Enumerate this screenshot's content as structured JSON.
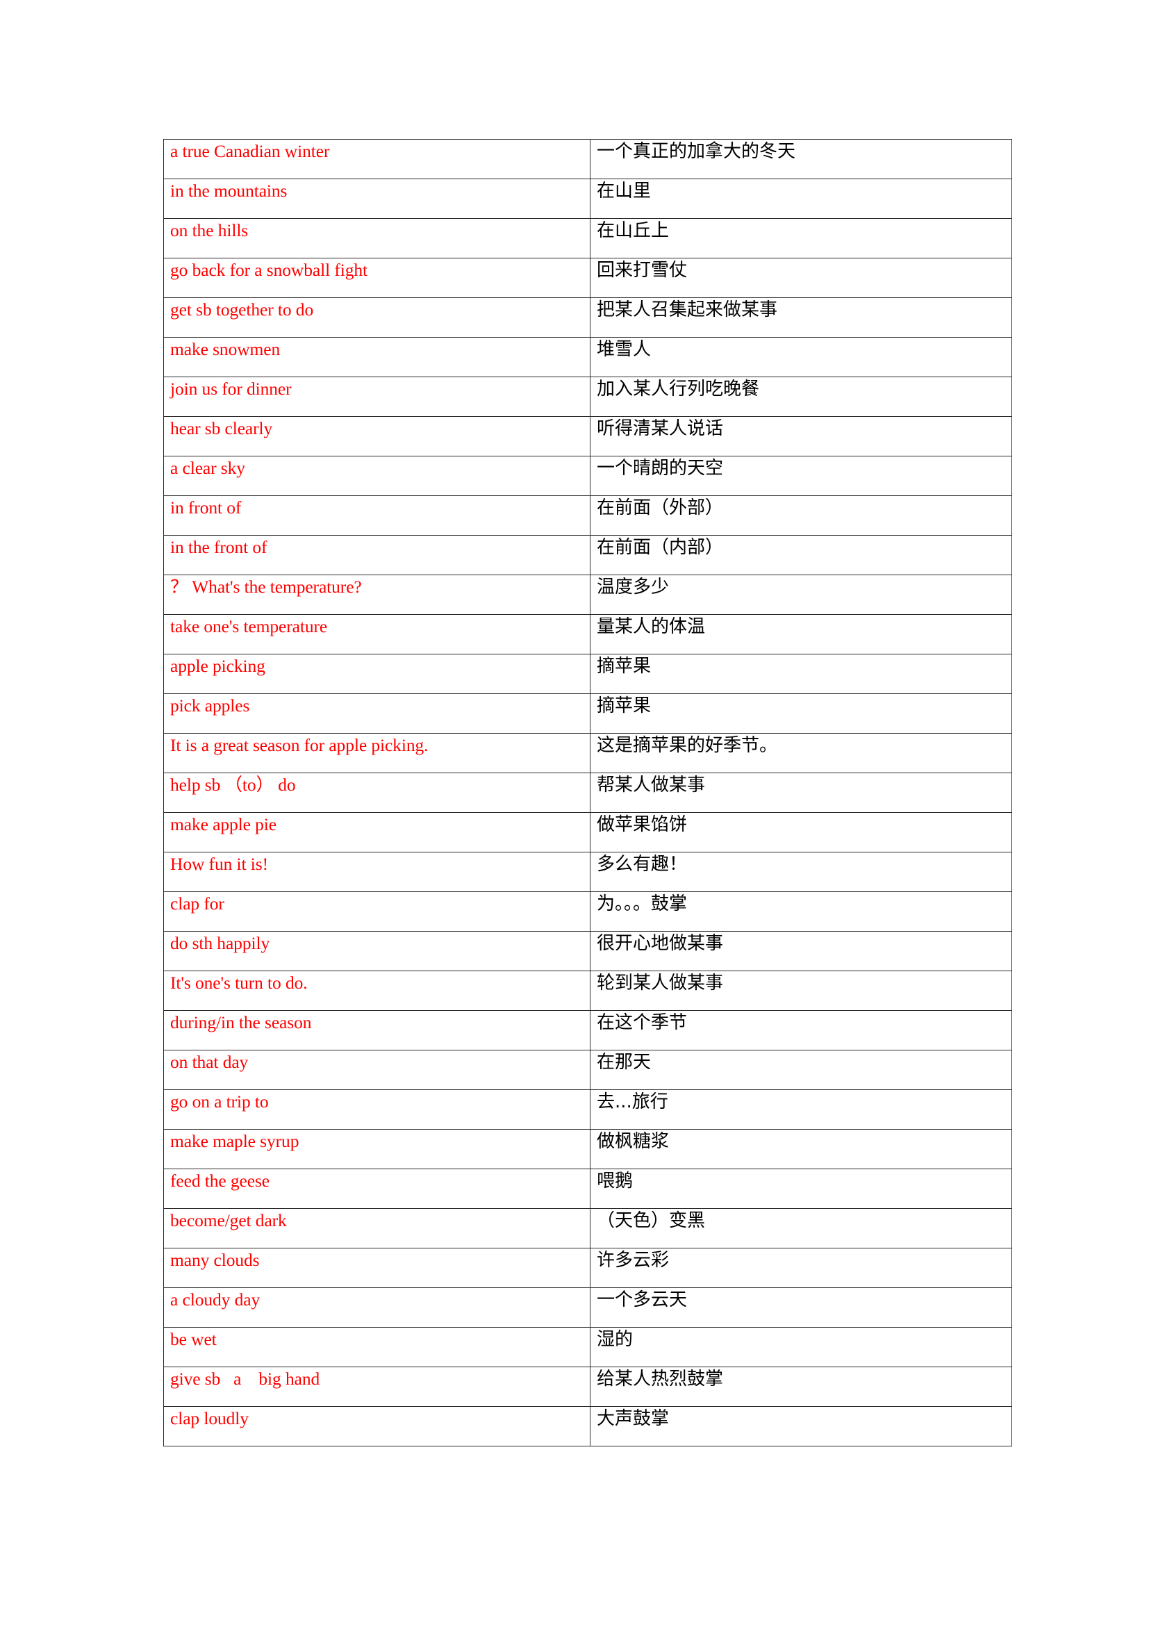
{
  "document": {
    "title": "English-Chinese Phrase Table",
    "colors": {
      "english_text": "#ff0000",
      "chinese_text": "#000000",
      "border": "#2b2b2b",
      "background": "#ffffff"
    }
  },
  "table": {
    "rows": [
      {
        "english": "a true Canadian winter",
        "chinese": "一个真正的加拿大的冬天"
      },
      {
        "english": "in the mountains",
        "chinese": "在山里"
      },
      {
        "english": "on the hills",
        "chinese": "在山丘上"
      },
      {
        "english": "go back for a snowball fight",
        "chinese": "回来打雪仗"
      },
      {
        "english": "get sb together to do",
        "chinese": "把某人召集起来做某事"
      },
      {
        "english": "make snowmen",
        "chinese": "堆雪人"
      },
      {
        "english": "join us for dinner",
        "chinese": "加入某人行列吃晚餐"
      },
      {
        "english": "hear sb clearly",
        "chinese": "听得清某人说话"
      },
      {
        "english": "a clear sky",
        "chinese": "一个晴朗的天空"
      },
      {
        "english": "in front of",
        "chinese": "在前面（外部）"
      },
      {
        "english": "in the front of",
        "chinese": "在前面（内部）"
      },
      {
        "english": "？ What's the temperature?",
        "chinese": "温度多少"
      },
      {
        "english": "take one's temperature",
        "chinese": "量某人的体温"
      },
      {
        "english": "apple picking",
        "chinese": "摘苹果"
      },
      {
        "english": "pick apples",
        "chinese": "摘苹果"
      },
      {
        "english": "It is a great season for apple picking.",
        "chinese": "这是摘苹果的好季节。"
      },
      {
        "english": "help sb （to） do",
        "chinese": "帮某人做某事"
      },
      {
        "english": "make apple pie",
        "chinese": "做苹果馅饼"
      },
      {
        "english": "How fun it is!",
        "chinese": "多么有趣！"
      },
      {
        "english": "clap for",
        "chinese": "为。。。鼓掌"
      },
      {
        "english": "do sth happily",
        "chinese": "很开心地做某事"
      },
      {
        "english": "It's one's turn to do.",
        "chinese": "轮到某人做某事"
      },
      {
        "english": "during/in the season",
        "chinese": "在这个季节"
      },
      {
        "english": "on that day",
        "chinese": "在那天"
      },
      {
        "english": "go on a trip to",
        "chinese": "去...旅行"
      },
      {
        "english": "make maple syrup",
        "chinese": "做枫糖浆"
      },
      {
        "english": "feed the geese",
        "chinese": "喂鹅"
      },
      {
        "english": "become/get dark",
        "chinese": "（天色）变黑"
      },
      {
        "english": "many clouds",
        "chinese": "许多云彩"
      },
      {
        "english": "a cloudy day",
        "chinese": "一个多云天"
      },
      {
        "english": "be wet",
        "chinese": "湿的"
      },
      {
        "english": "give sb   a    big hand",
        "chinese": "给某人热烈鼓掌"
      },
      {
        "english": "clap loudly",
        "chinese": "大声鼓掌"
      }
    ]
  }
}
